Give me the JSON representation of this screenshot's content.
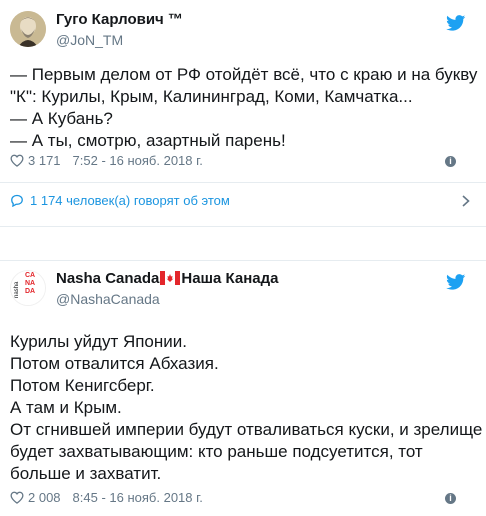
{
  "tweets": [
    {
      "author": {
        "name": "Гуго Карлович ™",
        "handle": "@JoN_TM"
      },
      "lines": [
        "— Первым делом от РФ отойдёт всё, что с краю и на букву",
        "\"К\": Курилы, Крым, Калининград, Коми, Камчатка...",
        "— А Кубань?",
        "— А ты, смотрю, азартный парень!"
      ],
      "likes": "3 171",
      "timestamp": "7:52 - 16 нояб. 2018 г.",
      "conversation": "1 174 человек(а) говорят об этом",
      "info_icon": "info-icon"
    },
    {
      "author": {
        "name": "Nasha Canada",
        "name_suffix": "Наша Канада",
        "handle": "@NashaCanada",
        "logo_text": "CANADA",
        "logo_text_side": "nasha"
      },
      "lines": [
        "Курилы уйдут Японии.",
        "Потом отвалится Абхазия.",
        "Потом Кенигсберг.",
        "А там и Крым.",
        "От сгнившей империи будут отваливаться куски, и зрелище",
        "будет захватывающим: кто раньше подсуетится, тот",
        "больше и захватит."
      ],
      "likes": "2 008",
      "timestamp": "8:45 - 16 нояб. 2018 г."
    }
  ],
  "colors": {
    "twitter_blue": "#1da1f2",
    "link_blue": "#1b95e0",
    "muted": "#657786",
    "canada_red": "#e3262b"
  }
}
